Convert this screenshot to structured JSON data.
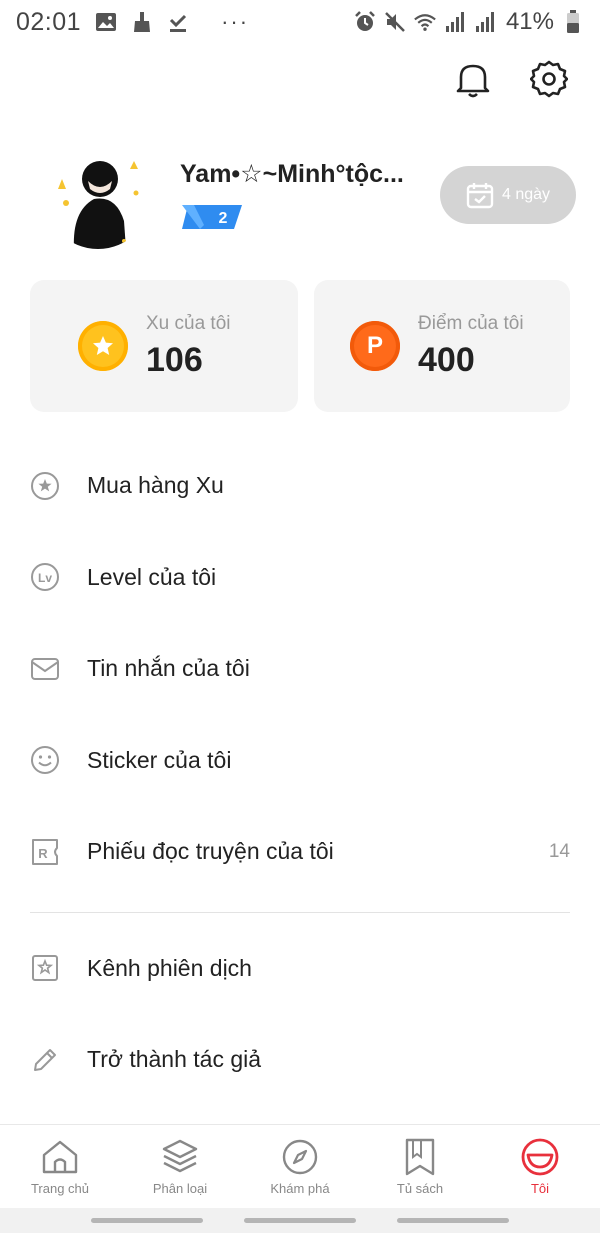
{
  "status_bar": {
    "time": "02:01",
    "more": "···",
    "battery": "41%"
  },
  "profile": {
    "username": "Yam•☆~Minh°tộc...",
    "level_badge": "2",
    "checkin_label": "4 ngày"
  },
  "cards": {
    "coins": {
      "label": "Xu của tôi",
      "value": "106"
    },
    "points": {
      "label": "Điểm của tôi",
      "value": "400",
      "icon_letter": "P"
    }
  },
  "menu": {
    "items": [
      {
        "label": "Mua hàng Xu",
        "icon": "coin-star-icon"
      },
      {
        "label": "Level của tôi",
        "icon": "level-icon"
      },
      {
        "label": "Tin nhắn của tôi",
        "icon": "mail-icon"
      },
      {
        "label": "Sticker của tôi",
        "icon": "smiley-icon"
      },
      {
        "label": "Phiếu đọc truyện của tôi",
        "icon": "ticket-icon",
        "count": "14"
      },
      {
        "label": "Kênh phiên dịch",
        "icon": "translate-icon"
      },
      {
        "label": "Trở thành tác giả",
        "icon": "pencil-icon"
      }
    ]
  },
  "nav": {
    "items": [
      {
        "label": "Trang chủ",
        "icon": "home-icon"
      },
      {
        "label": "Phân loại",
        "icon": "layers-icon"
      },
      {
        "label": "Khám phá",
        "icon": "compass-icon"
      },
      {
        "label": "Tủ sách",
        "icon": "bookmark-icon"
      },
      {
        "label": "Tôi",
        "icon": "profile-face-icon",
        "active": true
      }
    ]
  },
  "colors": {
    "accent": "#e8303c",
    "coin_gold": "#ffc21e",
    "points_orange": "#ff6a1a",
    "badge_blue": "#2f8cf0",
    "checkin_bg": "#d4d4d4"
  }
}
